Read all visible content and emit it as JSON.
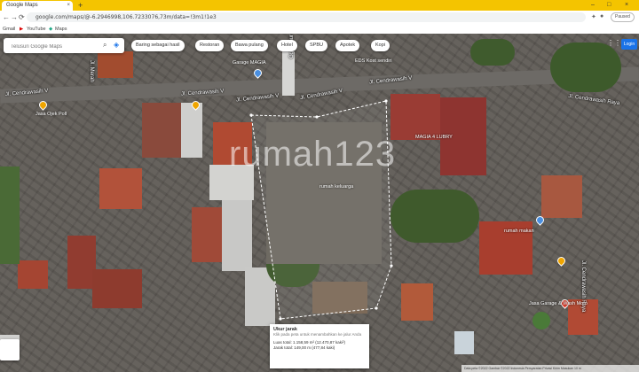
{
  "browser": {
    "tab_title": "Google Maps",
    "tab_close": "×",
    "new_tab": "+",
    "window_controls": [
      "–",
      "□",
      "×"
    ],
    "url": "google.com/maps/@-6.2946998,106.7233076,73m/data=!3m1!1e3",
    "nav": [
      "←",
      "→",
      "⟳"
    ],
    "paused_label": "Paused",
    "bookmarks": [
      "Gmail",
      "YouTube",
      "Maps"
    ]
  },
  "map": {
    "search_placeholder": "Telusuri Google Maps",
    "chips": [
      "Baring sebagai hasil",
      "Restoran",
      "Bawa pulang",
      "Hotel",
      "SPBU",
      "Apotek",
      "Kopi"
    ],
    "login_label": "Login",
    "roads": [
      "Jl. Cendrawasih V",
      "Jl. Cendrawasih V",
      "Jl. Cendrawasih V",
      "Jl. Cendrawasih V",
      "Jl. Cendrawasih V",
      "Jl. Cendrawasih Raya",
      "Jl. Cendrawasih Raya",
      "Jl. Merah",
      "Gg. Annur"
    ],
    "pois": [
      "Jasa Ojek Poll",
      "Garage MAGIA",
      "MAGIA 4 LUBRY",
      "rumah keluarga",
      "Jasa Garage & Wash Moto",
      "rumah makan",
      "EDS Kost sendiri"
    ],
    "watermark": "rumah123",
    "measure": {
      "title": "Ukur jarak",
      "subtitle": "Klik pada peta untuk menambahkan ke jalur Anda",
      "area": "Luas total: 1.158,59 m² (12.470,87 kaki²)",
      "distance": "Jarak total: 149,00 m (477,84 kaki)"
    },
    "footer": "Data peta ©2022 Gambar ©2022  Indonesia  Persyaratan  Privasi  Kirim Masukan  10 m"
  },
  "colors": {
    "tabbar": "#f4c400",
    "accent": "#1a73e8",
    "pin": "#f0a500"
  }
}
